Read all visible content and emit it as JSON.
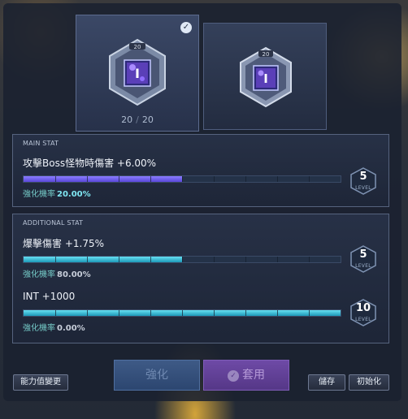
{
  "cards": [
    {
      "level_badge": "20",
      "count_current": "20",
      "count_total": "20",
      "selected": true
    },
    {
      "level_badge": "20",
      "selected": false
    }
  ],
  "main_stat": {
    "section_title": "MAIN STAT",
    "text": "攻擊Boss怪物時傷害 +6.00%",
    "rate_label": "強化機率",
    "rate_value": "20.00%",
    "progress_fraction": 0.5,
    "level": "5",
    "level_label": "LEVEL"
  },
  "additional_stat": {
    "section_title": "ADDITIONAL STAT",
    "items": [
      {
        "text": "爆擊傷害 +1.75%",
        "rate_label": "強化機率",
        "rate_value": "80.00%",
        "progress_fraction": 0.5,
        "level": "5",
        "level_label": "LEVEL"
      },
      {
        "text": "INT +1000",
        "rate_label": "強化機率",
        "rate_value": "0.00%",
        "progress_fraction": 1.0,
        "level": "10",
        "level_label": "LEVEL"
      }
    ]
  },
  "buttons": {
    "change_stats": "能力值變更",
    "enhance": "強化",
    "apply": "套用",
    "save": "儲存",
    "reset": "初始化"
  },
  "colors": {
    "main_bar": "#6a5cf0",
    "additional_bar": "#2fb8d4",
    "apply_button": "#6e4aa6",
    "enhance_button": "#3e5a86"
  },
  "icons": [
    "check-icon",
    "emblem-icon"
  ]
}
